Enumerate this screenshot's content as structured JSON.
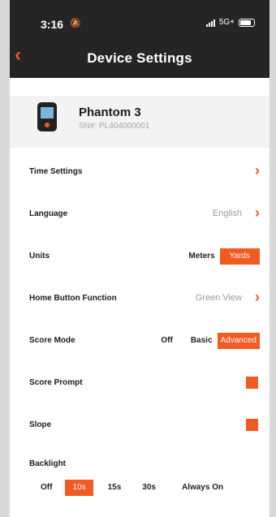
{
  "status": {
    "time": "3:16",
    "network": "5G+"
  },
  "header": {
    "title": "Device Settings"
  },
  "device": {
    "name": "Phantom 3",
    "serial": "SN#: PL404000001"
  },
  "settings": {
    "time_settings": {
      "label": "Time Settings"
    },
    "language": {
      "label": "Language",
      "value": "English"
    },
    "units": {
      "label": "Units",
      "options": [
        "Meters",
        "Yards"
      ],
      "selected": "Yards"
    },
    "home_button": {
      "label": "Home Button Function",
      "value": "Green View"
    },
    "score_mode": {
      "label": "Score Mode",
      "options": [
        "Off",
        "Basic",
        "Advanced"
      ],
      "selected": "Advanced"
    },
    "score_prompt": {
      "label": "Score Prompt",
      "enabled": true
    },
    "slope": {
      "label": "Slope",
      "enabled": true
    },
    "backlight": {
      "label": "Backlight",
      "options": [
        "Off",
        "10s",
        "15s",
        "30s",
        "Always On"
      ],
      "selected": "10s"
    }
  },
  "colors": {
    "accent": "#f15a22",
    "header_bg": "#252525",
    "background": "#ffffff"
  }
}
